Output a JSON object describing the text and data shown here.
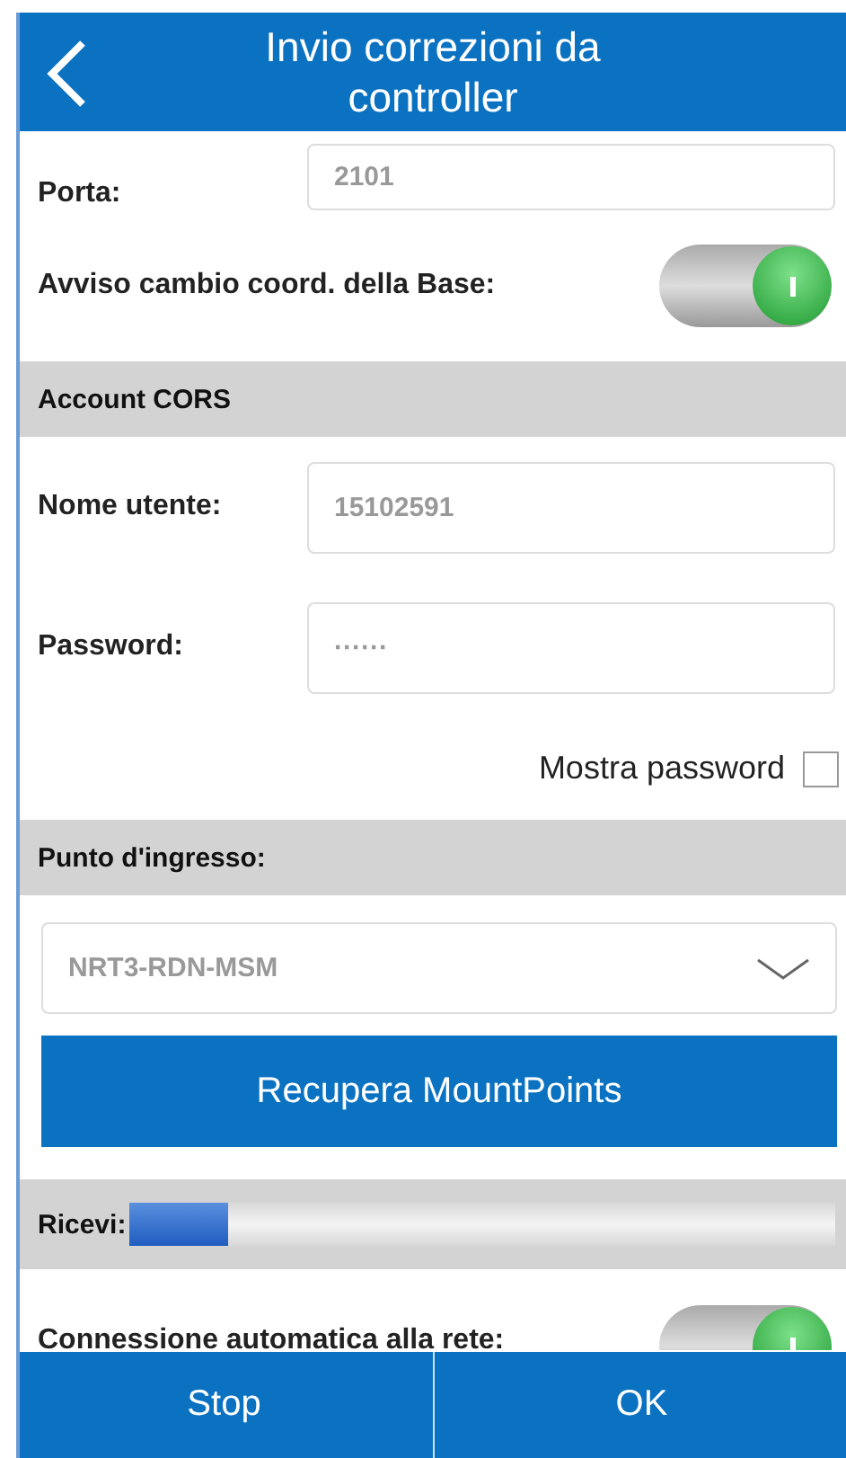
{
  "header": {
    "title": "Invio correzioni da controller"
  },
  "items": [
    {
      "kind": "field",
      "label": "Porta:",
      "value": "2101"
    },
    {
      "kind": "toggle",
      "label": "Avviso cambio coord. della Base:",
      "on": true
    },
    {
      "kind": "section",
      "label": "Account CORS"
    },
    {
      "kind": "field",
      "label": "Nome utente:",
      "value": "15102591"
    },
    {
      "kind": "field",
      "label": "Password:",
      "value": "······"
    },
    {
      "kind": "checkbox",
      "label": "Mostra password",
      "checked": false
    },
    {
      "kind": "section",
      "label": "Punto d'ingresso:"
    },
    {
      "kind": "dropdown",
      "value": "NRT3-RDN-MSM"
    },
    {
      "kind": "button",
      "label": "Recupera MountPoints"
    },
    {
      "kind": "progress",
      "label": "Ricevi:",
      "level": 0.14
    },
    {
      "kind": "toggle",
      "label": "Connessione automatica alla rete:",
      "on": true
    }
  ],
  "footer": [
    {
      "label": "Stop"
    },
    {
      "label": "OK"
    }
  ]
}
